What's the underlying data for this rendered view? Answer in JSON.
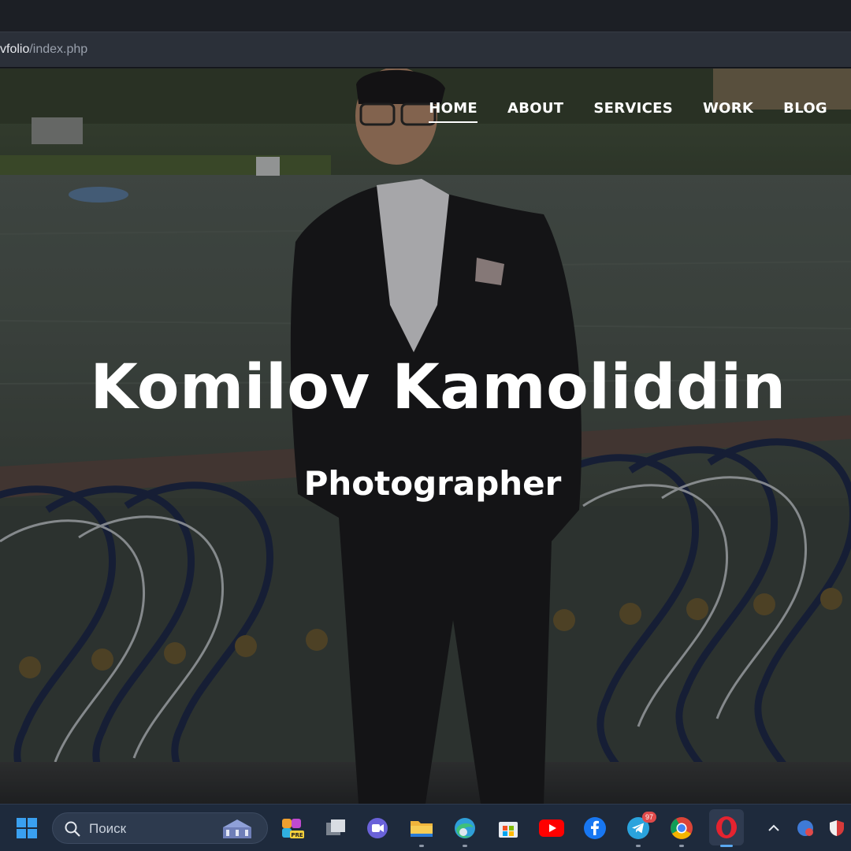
{
  "browser": {
    "url_prefix": "vfolio",
    "url_path": "/index.php"
  },
  "nav": {
    "items": [
      {
        "label": "HOME",
        "active": true
      },
      {
        "label": "ABOUT",
        "active": false
      },
      {
        "label": "SERVICES",
        "active": false
      },
      {
        "label": "WORK",
        "active": false
      },
      {
        "label": "BLOG",
        "active": false
      }
    ]
  },
  "hero": {
    "name": "Komilov Kamoliddin",
    "role": "Photographer"
  },
  "taskbar": {
    "search_placeholder": "Поиск",
    "telegram_badge": "97",
    "items": [
      "windows-start-icon",
      "search-icon",
      "copilot-icon",
      "task-view-icon",
      "teams-icon",
      "file-explorer-icon",
      "edge-icon",
      "microsoft-store-icon",
      "youtube-icon",
      "facebook-icon",
      "telegram-icon",
      "chrome-icon",
      "opera-icon",
      "chevron-up-icon",
      "tray-app-icon",
      "defender-icon"
    ]
  },
  "colors": {
    "taskbar_bg": "#1e2a3c",
    "nav_text": "#ffffff",
    "opera_red": "#e5232f",
    "youtube_red": "#ff0000",
    "facebook_blue": "#1877f2",
    "telegram_blue": "#2aa3dd"
  }
}
